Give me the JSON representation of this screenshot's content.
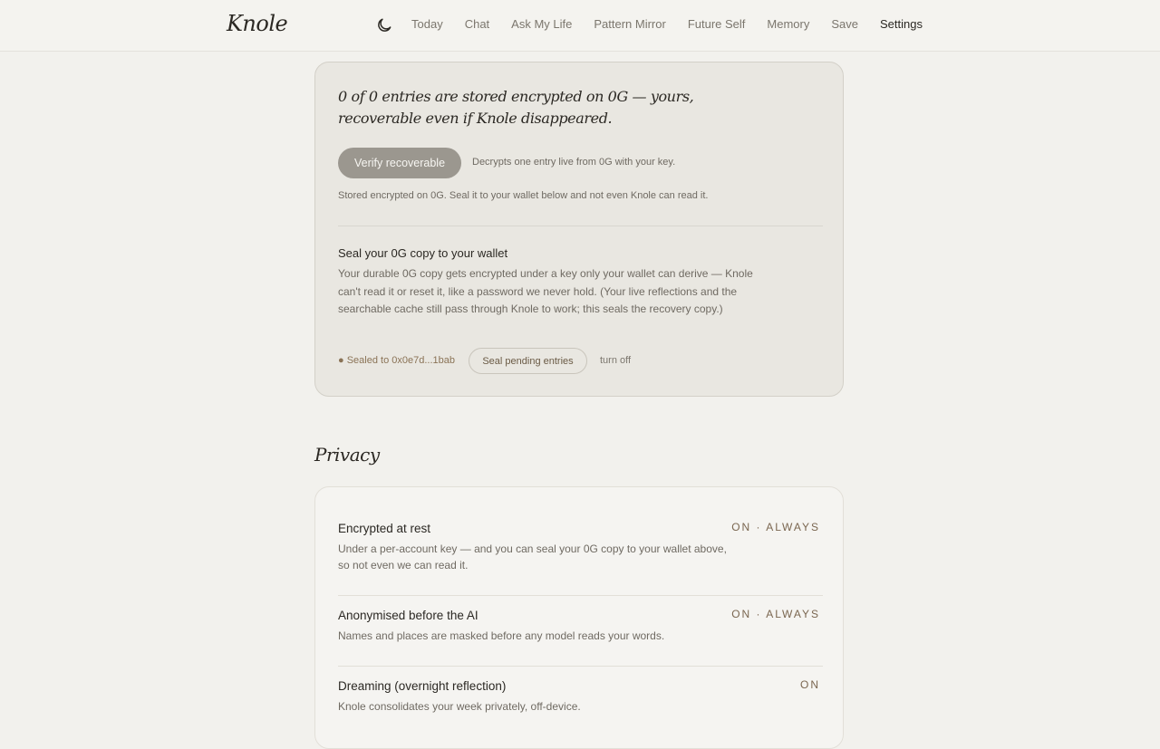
{
  "nav": {
    "logo": "Knole",
    "theme_icon": "moon-icon",
    "links": [
      "Today",
      "Chat",
      "Ask My Life",
      "Pattern Mirror",
      "Future Self",
      "Memory",
      "Save",
      "Settings"
    ],
    "active": "Settings"
  },
  "storage": {
    "headline": "0 of 0 entries are stored encrypted on 0G — yours, recoverable even if Knole disappeared.",
    "verify_button": "Verify recoverable",
    "verify_note": "Decrypts one entry live from 0G with your key.",
    "stored_note": "Stored encrypted on 0G. Seal it to your wallet below and not even Knole can read it.",
    "seal_title": "Seal your 0G copy to your wallet",
    "seal_desc": "Your durable 0G copy gets encrypted under a key only your wallet can derive — Knole can't read it or reset it, like a password we never hold. (Your live reflections and the searchable cache still pass through Knole to work; this seals the recovery copy.)",
    "sealed_to": "● Sealed to 0x0e7d...1bab",
    "seal_button": "Seal pending entries",
    "turn_off": "turn off"
  },
  "privacy": {
    "title": "Privacy",
    "rows": [
      {
        "title": "Encrypted at rest",
        "desc": "Under a per-account key — and you can seal your 0G copy to your wallet above, so not even we can read it.",
        "status": "ON · ALWAYS"
      },
      {
        "title": "Anonymised before the AI",
        "desc": "Names and places are masked before any model reads your words.",
        "status": "ON · ALWAYS"
      },
      {
        "title": "Dreaming (overnight reflection)",
        "desc": "Knole consolidates your week privately, off-device.",
        "status": "ON"
      }
    ]
  }
}
